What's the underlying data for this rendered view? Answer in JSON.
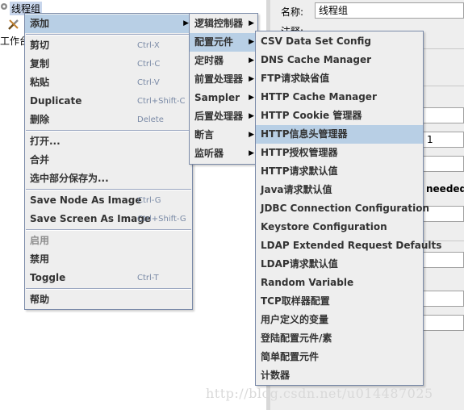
{
  "tree": {
    "root_label": "线程组",
    "workbench_label": "工作台"
  },
  "right_panel": {
    "name_label": "名称:",
    "name_value": "线程组",
    "comment_label": "注释:",
    "field_value": "1",
    "needed_text": "needed"
  },
  "menu_main": {
    "items": [
      {
        "label": "添加",
        "shortcut": "",
        "submenu": true,
        "highlighted": true,
        "enabled": true
      },
      {
        "label": "剪切",
        "shortcut": "Ctrl-X",
        "enabled": true
      },
      {
        "label": "复制",
        "shortcut": "Ctrl-C",
        "enabled": true
      },
      {
        "label": "粘贴",
        "shortcut": "Ctrl-V",
        "enabled": true
      },
      {
        "label": "Duplicate",
        "shortcut": "Ctrl+Shift-C",
        "enabled": true
      },
      {
        "label": "删除",
        "shortcut": "Delete",
        "enabled": true
      },
      {
        "label": "打开...",
        "shortcut": "",
        "enabled": true
      },
      {
        "label": "合并",
        "shortcut": "",
        "enabled": true
      },
      {
        "label": "选中部分保存为...",
        "shortcut": "",
        "enabled": true
      },
      {
        "label": "Save Node As Image",
        "shortcut": "Ctrl-G",
        "enabled": true
      },
      {
        "label": "Save Screen As Image",
        "shortcut": "Ctrl+Shift-G",
        "enabled": true
      },
      {
        "label": "启用",
        "shortcut": "",
        "enabled": false
      },
      {
        "label": "禁用",
        "shortcut": "",
        "enabled": true
      },
      {
        "label": "Toggle",
        "shortcut": "Ctrl-T",
        "enabled": true
      },
      {
        "label": "帮助",
        "shortcut": "",
        "enabled": true
      }
    ]
  },
  "menu_add": {
    "items": [
      {
        "label": "逻辑控制器",
        "highlighted": false
      },
      {
        "label": "配置元件",
        "highlighted": true
      },
      {
        "label": "定时器",
        "highlighted": false
      },
      {
        "label": "前置处理器",
        "highlighted": false
      },
      {
        "label": "Sampler",
        "highlighted": false
      },
      {
        "label": "后置处理器",
        "highlighted": false
      },
      {
        "label": "断言",
        "highlighted": false
      },
      {
        "label": "监听器",
        "highlighted": false
      }
    ]
  },
  "menu_config": {
    "items": [
      {
        "label": "CSV Data Set Config",
        "highlighted": false
      },
      {
        "label": "DNS Cache Manager",
        "highlighted": false
      },
      {
        "label": "FTP请求缺省值",
        "highlighted": false
      },
      {
        "label": "HTTP Cache Manager",
        "highlighted": false
      },
      {
        "label": "HTTP Cookie 管理器",
        "highlighted": false
      },
      {
        "label": "HTTP信息头管理器",
        "highlighted": true
      },
      {
        "label": "HTTP授权管理器",
        "highlighted": false
      },
      {
        "label": "HTTP请求默认值",
        "highlighted": false
      },
      {
        "label": "Java请求默认值",
        "highlighted": false
      },
      {
        "label": "JDBC Connection Configuration",
        "highlighted": false
      },
      {
        "label": "Keystore Configuration",
        "highlighted": false
      },
      {
        "label": "LDAP Extended Request Defaults",
        "highlighted": false
      },
      {
        "label": "LDAP请求默认值",
        "highlighted": false
      },
      {
        "label": "Random Variable",
        "highlighted": false
      },
      {
        "label": "TCP取样器配置",
        "highlighted": false
      },
      {
        "label": "用户定义的变量",
        "highlighted": false
      },
      {
        "label": "登陆配置元件/素",
        "highlighted": false
      },
      {
        "label": "简单配置元件",
        "highlighted": false
      },
      {
        "label": "计数器",
        "highlighted": false
      }
    ]
  },
  "watermark": "http://blog.csdn.net/u014487025",
  "colors": {
    "menu_bg": "#eeeeee",
    "highlight": "#b8cfe5",
    "shortcut": "#7a8aa6",
    "disabled": "#8d8d8d"
  }
}
